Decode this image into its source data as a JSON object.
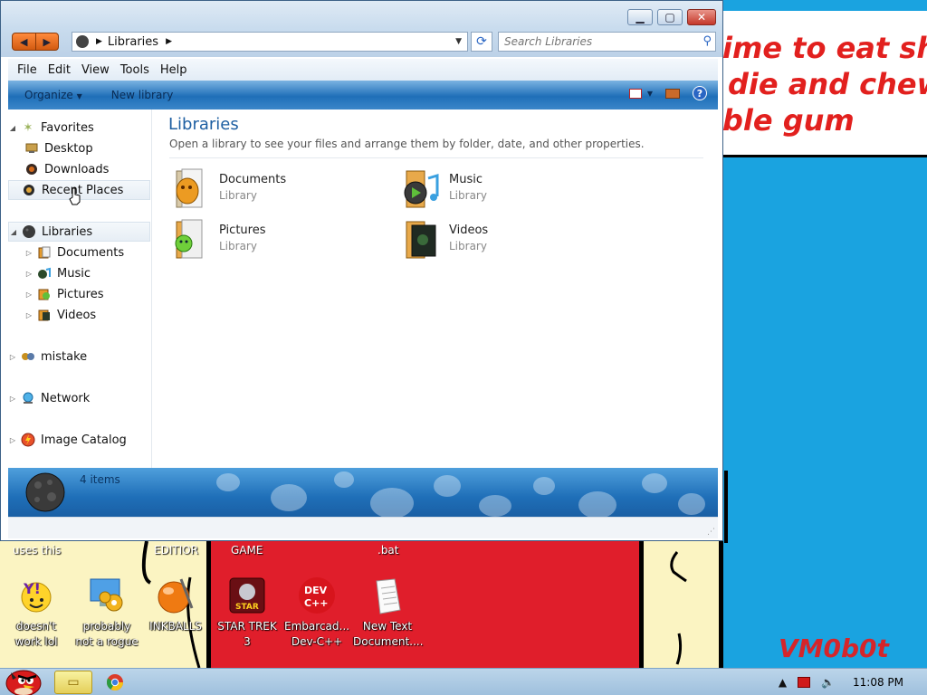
{
  "window": {
    "location": "Libraries",
    "search_placeholder": "Search Libraries",
    "menu": [
      "File",
      "Edit",
      "View",
      "Tools",
      "Help"
    ],
    "commands": [
      "Organize",
      "New library"
    ],
    "status_count": "4 items"
  },
  "navigation": {
    "favorites": {
      "label": "Favorites",
      "items": [
        "Desktop",
        "Downloads",
        "Recent Places"
      ]
    },
    "libraries": {
      "label": "Libraries",
      "items": [
        "Documents",
        "Music",
        "Pictures",
        "Videos"
      ]
    },
    "other": [
      "mistake",
      "Network",
      "Image Catalog"
    ]
  },
  "content": {
    "title": "Libraries",
    "subtitle": "Open a library to see your files and arrange them by folder, date, and other properties.",
    "libraries": [
      {
        "name": "Documents",
        "type": "Library"
      },
      {
        "name": "Music",
        "type": "Library"
      },
      {
        "name": "Pictures",
        "type": "Library"
      },
      {
        "name": "Videos",
        "type": "Library"
      }
    ]
  },
  "desktop": {
    "speech_lines": [
      "ime to eat shit",
      "die and chew",
      "ble gum"
    ],
    "graffiti": "VM0b0t",
    "captions": [
      "uses this",
      "EDITIOR",
      "GAME",
      ".bat"
    ],
    "icons": [
      {
        "label": "doesn't work lol",
        "icon": "yahoo-messenger-icon"
      },
      {
        "label": "probably not a rogue",
        "icon": "settings-gears-icon"
      },
      {
        "label": "INKBALLS",
        "icon": "inkball-icon"
      },
      {
        "label": "STAR TREK 3",
        "icon": "star-wars-game-icon"
      },
      {
        "label": "Embarcad... Dev-C++",
        "icon": "dev-cpp-icon"
      },
      {
        "label": "New Text Document....",
        "icon": "text-document-icon"
      }
    ]
  },
  "taskbar": {
    "time": "11:08 PM"
  },
  "colors": {
    "accent_blue": "#1e5fa2",
    "desktop_blue": "#1aa3e0",
    "red": "#e01e2b"
  }
}
